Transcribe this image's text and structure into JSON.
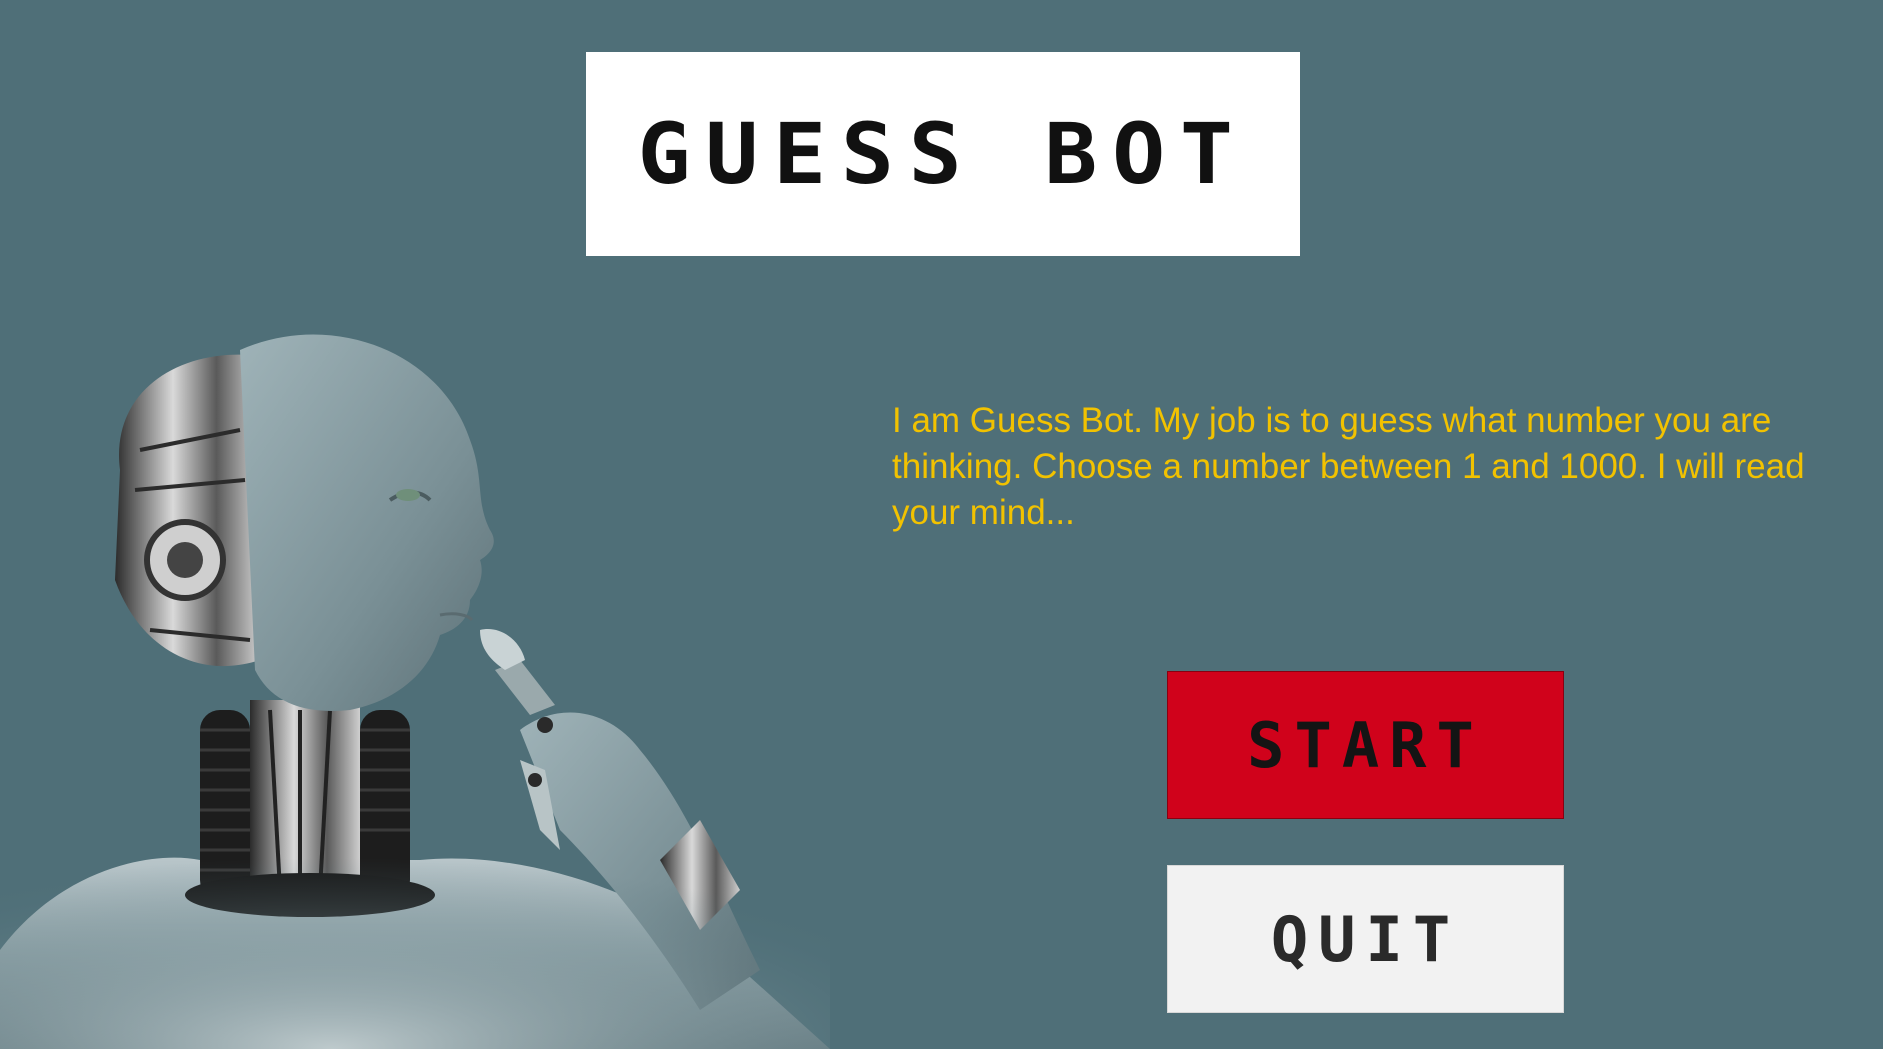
{
  "title": "GUESS BOT",
  "intro_text": "I am Guess Bot. My job is to guess what number you are thinking. Choose a number between 1 and 1000. I will read your mind...",
  "buttons": {
    "start_label": "START",
    "quit_label": "QUIT"
  },
  "colors": {
    "background": "#4f6f78",
    "intro_text": "#f2c200",
    "start_button": "#d0021b",
    "quit_button": "#f2f2f2"
  },
  "illustration": "thinking-robot-image"
}
